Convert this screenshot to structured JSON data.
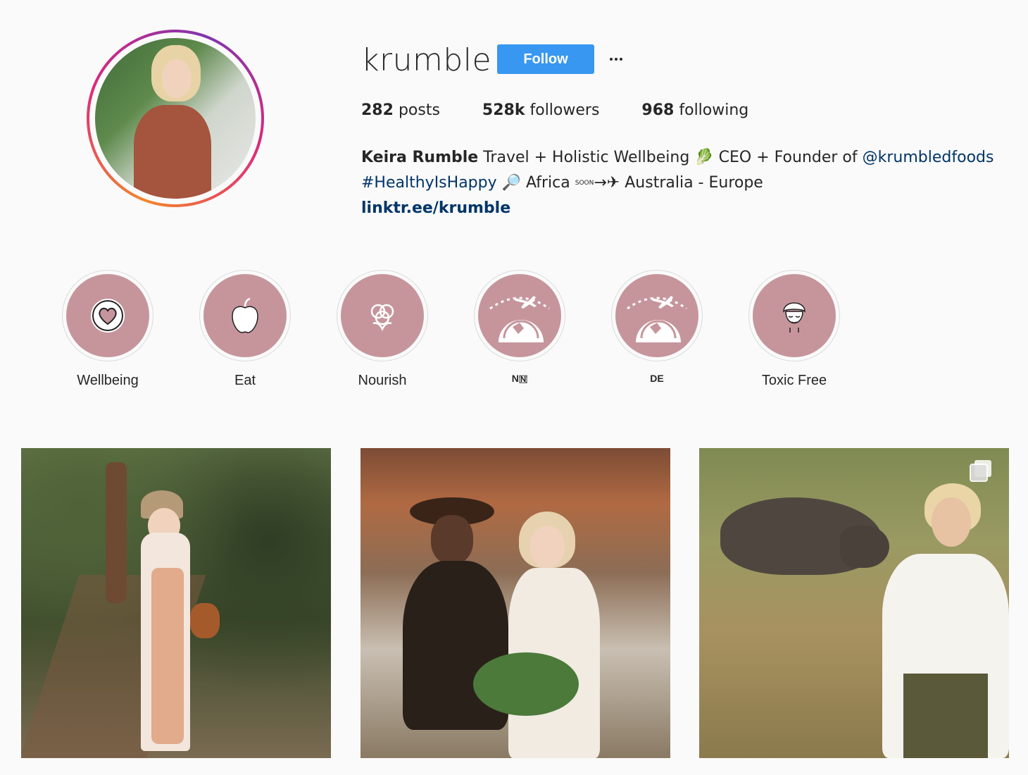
{
  "profile": {
    "username": "krumble",
    "follow_label": "Follow",
    "stats": {
      "posts_count": "282",
      "posts_label": "posts",
      "followers_count": "528k",
      "followers_label": "followers",
      "following_count": "968",
      "following_label": "following"
    },
    "bio": {
      "name": "Keira Rumble",
      "line1_text": " Travel + Holistic Wellbeing 🥬 CEO + Founder of ",
      "mention": "@krumbledfoods",
      "hashtag": "#HealthyIsHappy",
      "line2_text": " 🔎 Africa ",
      "soon": "SOON",
      "line2_rest": "→✈ Australia - Europe",
      "link": "linktr.ee/krumble"
    }
  },
  "highlights": [
    {
      "label": "Wellbeing",
      "icon": "heart-icon"
    },
    {
      "label": "Eat",
      "icon": "apple-icon"
    },
    {
      "label": "Nourish",
      "icon": "flower-icon"
    },
    {
      "label": "N🇳",
      "icon": "globe-plane-icon"
    },
    {
      "label": "DE",
      "icon": "globe-plane-icon"
    },
    {
      "label": "Toxic Free",
      "icon": "face-towel-icon"
    }
  ],
  "colors": {
    "accent": "#3897f0",
    "highlight_bg": "#c6959c",
    "link": "#003569"
  },
  "posts": [
    {
      "alt": "",
      "multi": false
    },
    {
      "alt": "",
      "multi": false
    },
    {
      "alt": "",
      "multi": true
    }
  ]
}
